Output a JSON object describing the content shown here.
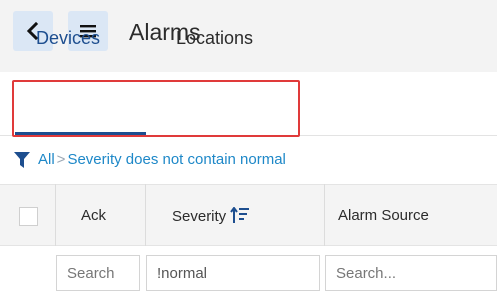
{
  "header": {
    "title": "Alarms"
  },
  "tabs": [
    {
      "label": "Devices"
    },
    {
      "label": "Locations"
    }
  ],
  "filter": {
    "root": "All",
    "separator": ">",
    "condition": "Severity does not contain normal"
  },
  "table": {
    "columns": [
      {
        "label": "Ack"
      },
      {
        "label": "Severity"
      },
      {
        "label": "Alarm Source"
      }
    ],
    "search_inputs": [
      {
        "value": "",
        "placeholder": "Search"
      },
      {
        "value": "!normal",
        "placeholder": ""
      },
      {
        "value": "",
        "placeholder": "Search..."
      }
    ]
  },
  "colors": {
    "accent": "#1d4e8f",
    "link": "#1e88c8",
    "highlight": "#e03a3a",
    "button_bg": "#dbe7f5"
  },
  "icons": {
    "back": "chevron-left-icon",
    "menu": "hamburger-icon",
    "filter": "funnel-icon",
    "sort": "sort-ascending-icon"
  }
}
